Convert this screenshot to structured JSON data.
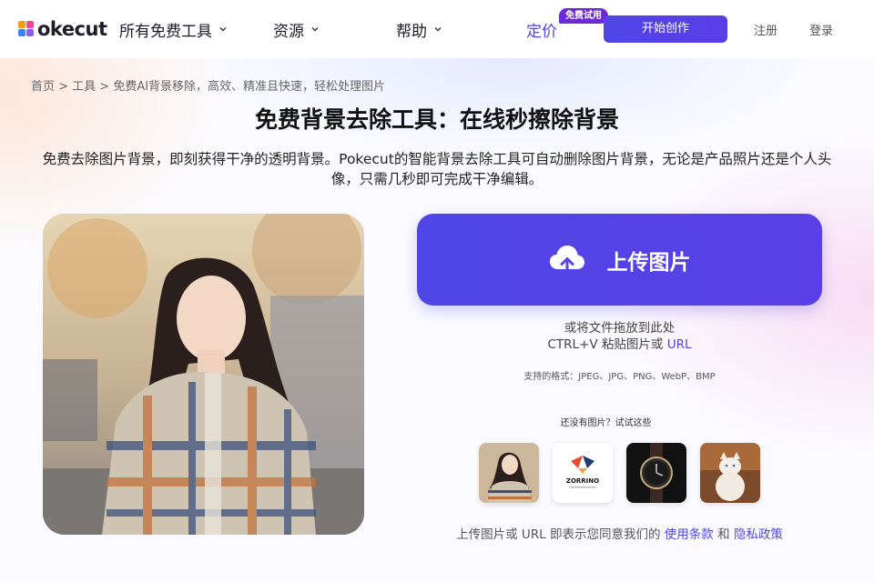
{
  "header": {
    "logo_text": "okecut",
    "nav": [
      {
        "label": "所有免费工具"
      },
      {
        "label": "资源"
      },
      {
        "label": "帮助"
      }
    ],
    "pricing_label": "定价",
    "free_badge": "免费试用",
    "start_label": "开始创作",
    "register_label": "注册",
    "login_label": "登录"
  },
  "main": {
    "breadcrumb": "首页 > 工具 > 免费AI背景移除，高效、精准且快速，轻松处理图片",
    "title": "免费背景去除工具：在线秒擦除背景",
    "subtitle": "免费去除图片背景，即刻获得干净的透明背景。Pokecut的智能背景去除工具可自动删除图片背景，无论是产品照片还是个人头像，只需几秒即可完成干净编辑。",
    "upload_label": "上传图片",
    "drop_hint": "或将文件拖放到此处",
    "paste_hint_prefix": "CTRL+V 粘贴图片或 ",
    "paste_hint_url": "URL",
    "formats": "支持的格式：JPEG、JPG、PNG、WebP、BMP",
    "try_label": "还没有图片？试试这些",
    "terms_prefix": "上传图片或 URL 即表示您同意我们的 ",
    "terms_link": "使用条款",
    "terms_and": " 和 ",
    "privacy_link": "隐私政策"
  },
  "samples": [
    {
      "name": "sample-portrait"
    },
    {
      "name": "sample-logo",
      "caption": "ZORRINO"
    },
    {
      "name": "sample-watch"
    },
    {
      "name": "sample-cat"
    }
  ],
  "colors": {
    "accent": "#4f46e5",
    "badge": "#6d28d9"
  }
}
